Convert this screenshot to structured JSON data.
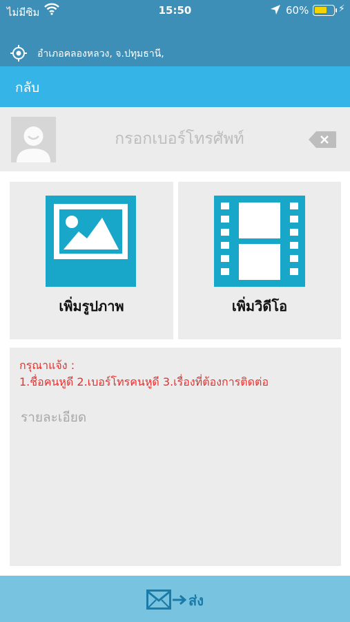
{
  "status_bar": {
    "carrier": "ไม่มีซิม",
    "time": "15:50",
    "battery_percent": "60%",
    "battery_level": 0.6,
    "icons": [
      "wifi-icon",
      "location-arrow-icon",
      "battery-icon",
      "charging-bolt-icon"
    ]
  },
  "location": {
    "text": "อำเภอคลองหลวง, จ.ปทุมธานี,",
    "icon": "gps-target-icon"
  },
  "nav": {
    "back_label": "กลับ"
  },
  "phone": {
    "placeholder": "กรอกเบอร์โทรศัพท์",
    "value": ""
  },
  "media": {
    "add_photo_label": "เพิ่มรูปภาพ",
    "add_video_label": "เพิ่มวิดีโอ"
  },
  "notice": {
    "title": "กรุณาแจ้ง :",
    "text": "1.ชื่อคนหูดี 2.เบอร์โทรคนหูดี 3.เรื่องที่ต้องการติดต่อ"
  },
  "detail": {
    "placeholder": "รายละเอียด",
    "value": ""
  },
  "send": {
    "label": "ส่ง"
  },
  "colors": {
    "header_dark": "#3e8fb8",
    "nav_blue": "#35b4e8",
    "icon_teal": "#19a7c9",
    "notice_red": "#e8302e",
    "send_bar": "#78c3df",
    "panel_gray": "#ececec"
  }
}
